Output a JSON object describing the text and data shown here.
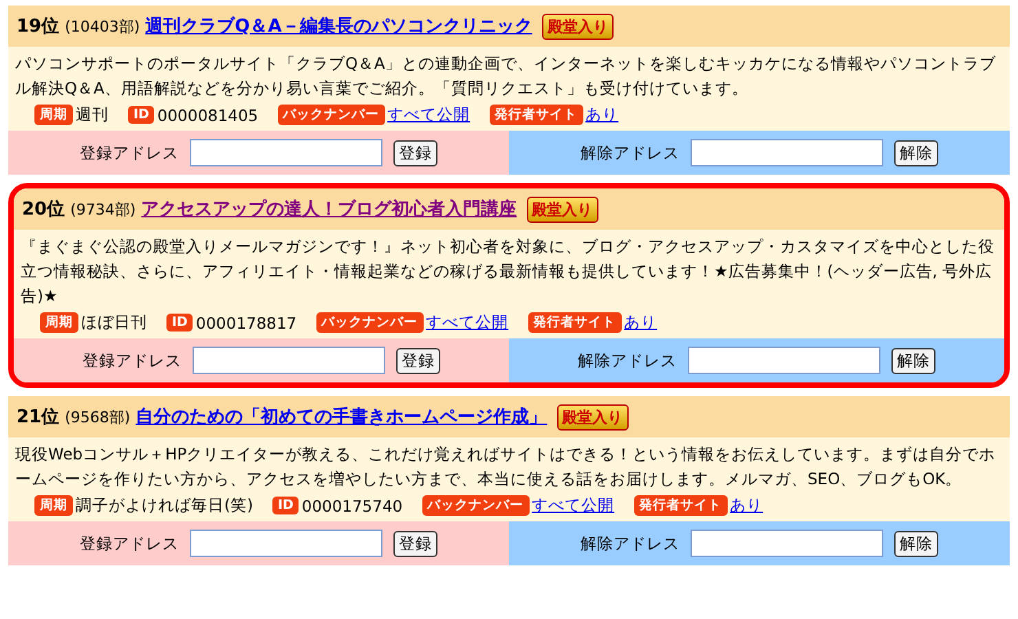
{
  "entries": [
    {
      "rank": "19位",
      "readers": "(10403部)",
      "title": "週刊クラブQ＆A－編集長のパソコンクリニック",
      "visited": false,
      "highlighted": false,
      "award": "殿堂入り",
      "description": "パソコンサポートのポータルサイト「クラブQ＆A」との連動企画で、インターネットを楽しむキッカケになる情報やパソコントラブル解決Q＆A、用語解説などを分かり易い言葉でご紹介。「質問リクエスト」も受け付けています。",
      "meta": [
        {
          "label": "周期",
          "value": "週刊",
          "kind": "text"
        },
        {
          "label": "ID",
          "value": "0000081405",
          "kind": "text"
        },
        {
          "label": "バックナンバー",
          "value": "すべて公開",
          "kind": "link"
        },
        {
          "label": "発行者サイト",
          "value": "あり",
          "kind": "link"
        }
      ],
      "subscribe": {
        "label": "登録アドレス",
        "button": "登録"
      },
      "unsubscribe": {
        "label": "解除アドレス",
        "button": "解除"
      }
    },
    {
      "rank": "20位",
      "readers": "(9734部)",
      "title": "アクセスアップの達人！ブログ初心者入門講座",
      "visited": true,
      "highlighted": true,
      "award": "殿堂入り",
      "description": "『まぐまぐ公認の殿堂入りメールマガジンです！』ネット初心者を対象に、ブログ・アクセスアップ・カスタマイズを中心とした役立つ情報秘訣、さらに、アフィリエイト・情報起業などの稼げる最新情報も提供しています！★広告募集中！(ヘッダー広告, 号外広告)★",
      "meta": [
        {
          "label": "周期",
          "value": "ほぼ日刊",
          "kind": "text"
        },
        {
          "label": "ID",
          "value": "0000178817",
          "kind": "text"
        },
        {
          "label": "バックナンバー",
          "value": "すべて公開",
          "kind": "link"
        },
        {
          "label": "発行者サイト",
          "value": "あり",
          "kind": "link"
        }
      ],
      "subscribe": {
        "label": "登録アドレス",
        "button": "登録"
      },
      "unsubscribe": {
        "label": "解除アドレス",
        "button": "解除"
      }
    },
    {
      "rank": "21位",
      "readers": "(9568部)",
      "title": "自分のための「初めての手書きホームページ作成」",
      "visited": false,
      "highlighted": false,
      "award": "殿堂入り",
      "description": "現役Webコンサル＋HPクリエイターが教える、これだけ覚えればサイトはできる！という情報をお伝えしています。まずは自分でホームページを作りたい方から、アクセスを増やしたい方まで、本当に使える話をお届けします。メルマガ、SEO、ブログもOK。",
      "meta": [
        {
          "label": "周期",
          "value": "調子がよければ毎日(笑)",
          "kind": "text"
        },
        {
          "label": "ID",
          "value": "0000175740",
          "kind": "text"
        },
        {
          "label": "バックナンバー",
          "value": "すべて公開",
          "kind": "link"
        },
        {
          "label": "発行者サイト",
          "value": "あり",
          "kind": "link"
        }
      ],
      "subscribe": {
        "label": "登録アドレス",
        "button": "登録"
      },
      "unsubscribe": {
        "label": "解除アドレス",
        "button": "解除"
      }
    }
  ]
}
